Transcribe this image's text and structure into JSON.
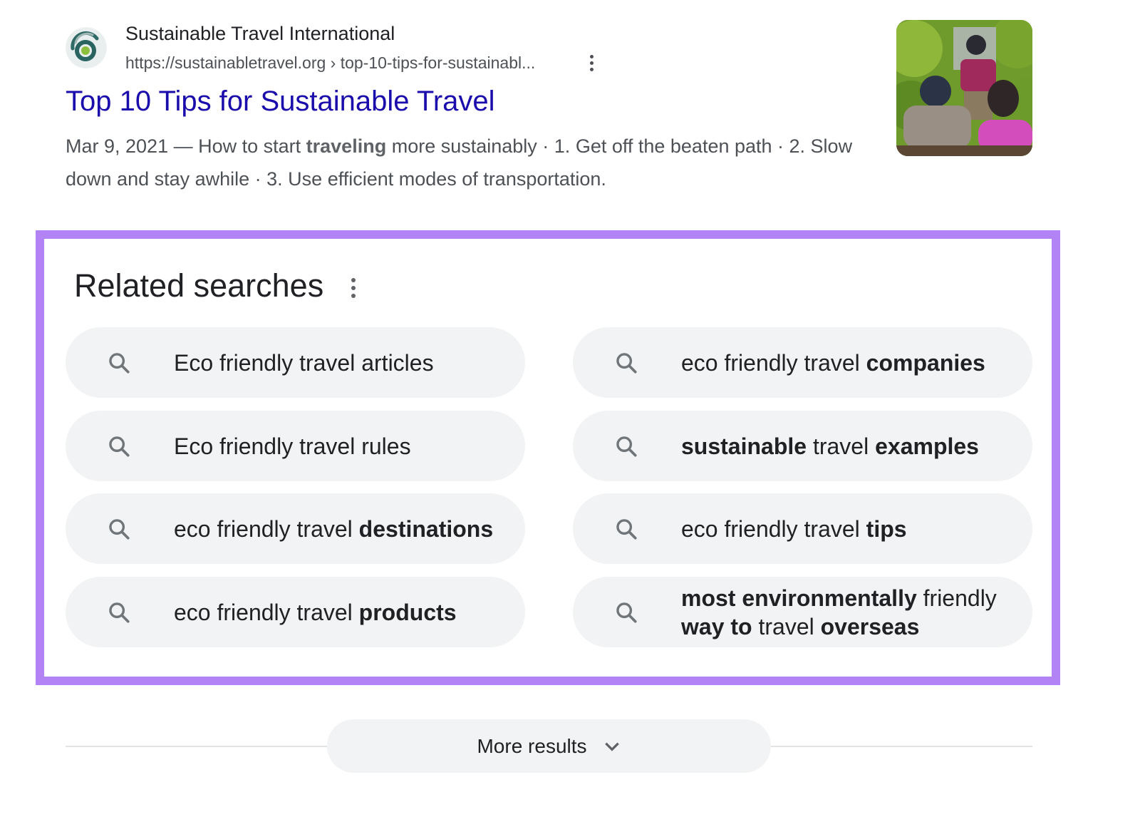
{
  "result": {
    "site_name": "Sustainable Travel International",
    "url": "https://sustainabletravel.org › top-10-tips-for-sustainabl...",
    "title": "Top 10 Tips for Sustainable Travel",
    "snippet": {
      "date": "Mar 9, 2021",
      "separator": " — ",
      "before_bold": "How to start ",
      "bold": "traveling",
      "after_bold": " more sustainably · 1. Get off the beaten path · 2. Slow down and stay awhile · 3. Use efficient modes of transportation."
    },
    "favicon_icon": "sustainable-travel-logo-icon",
    "menu_icon": "more-vert-icon",
    "thumbnail_alt": "Travelers in a boat on a jungle river"
  },
  "related_searches": {
    "title": "Related searches",
    "menu_icon": "more-vert-icon",
    "item_icon": "search-icon",
    "highlight_color": "#b283f4",
    "items": [
      {
        "segments": [
          {
            "text": "Eco friendly travel articles",
            "bold": false
          }
        ]
      },
      {
        "segments": [
          {
            "text": "eco friendly travel ",
            "bold": false
          },
          {
            "text": "companies",
            "bold": true
          }
        ]
      },
      {
        "segments": [
          {
            "text": "Eco friendly travel rules",
            "bold": false
          }
        ]
      },
      {
        "segments": [
          {
            "text": "sustainable",
            "bold": true
          },
          {
            "text": " travel ",
            "bold": false
          },
          {
            "text": "examples",
            "bold": true
          }
        ]
      },
      {
        "segments": [
          {
            "text": "eco friendly travel ",
            "bold": false
          },
          {
            "text": "destinations",
            "bold": true
          }
        ]
      },
      {
        "segments": [
          {
            "text": "eco friendly travel ",
            "bold": false
          },
          {
            "text": "tips",
            "bold": true
          }
        ]
      },
      {
        "segments": [
          {
            "text": "eco friendly travel ",
            "bold": false
          },
          {
            "text": "products",
            "bold": true
          }
        ]
      },
      {
        "segments": [
          {
            "text": "most environmentally",
            "bold": true
          },
          {
            "text": " friendly ",
            "bold": false
          },
          {
            "text": "way to",
            "bold": true
          },
          {
            "text": " travel ",
            "bold": false
          },
          {
            "text": "overseas",
            "bold": true
          }
        ]
      }
    ]
  },
  "more_results": {
    "label": "More results",
    "icon": "chevron-down-icon"
  }
}
